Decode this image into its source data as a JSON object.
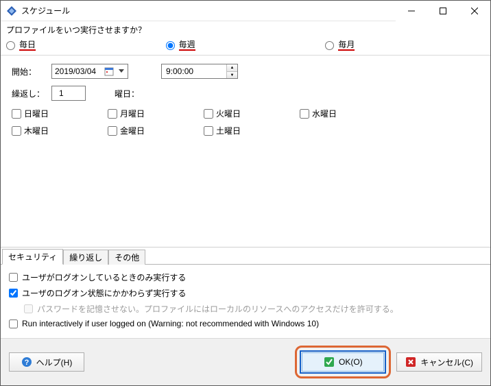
{
  "title": "スケジュール",
  "prompt": "プロファイルをいつ実行させますか？",
  "frequency": {
    "daily": "毎日",
    "weekly": "毎週",
    "monthly": "毎月",
    "selected": "weekly"
  },
  "start": {
    "label": "開始：",
    "date": "2019/03/04",
    "time": "9:00:00"
  },
  "repeat": {
    "label": "繰返し：",
    "value": "1",
    "dow_label": "曜日："
  },
  "days": {
    "sun": "日曜日",
    "mon": "月曜日",
    "tue": "火曜日",
    "wed": "水曜日",
    "thu": "木曜日",
    "fri": "金曜日",
    "sat": "土曜日"
  },
  "tabs": {
    "security": "セキュリティ",
    "repeat": "繰り返し",
    "other": "その他"
  },
  "security_opts": {
    "only_logged_on": "ユーザがログオンしているときのみ実行する",
    "regardless": "ユーザのログオン状態にかかわらず実行する",
    "no_save_pw": "パスワードを記憶させない。プロファイルにはローカルのリソースへのアクセスだけを許可する。",
    "interactive": "Run interactively if user logged on (Warning: not recommended with Windows 10)"
  },
  "buttons": {
    "help": "ヘルプ(H)",
    "ok": "OK(O)",
    "cancel": "キャンセル(C)"
  }
}
